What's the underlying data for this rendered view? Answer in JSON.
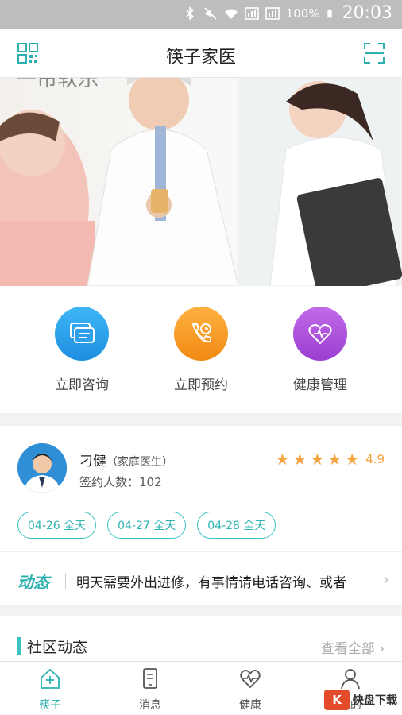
{
  "status_bar": {
    "battery": "100%",
    "time": "20:03"
  },
  "app_bar": {
    "title": "筷子家医"
  },
  "banner": {
    "overlay_text": "一帘软乐",
    "page_count": 3,
    "active_page": 2
  },
  "quick_actions": [
    {
      "label": "立即咨询",
      "icon": "chat-bubbles-icon",
      "color": "#2f9ce8"
    },
    {
      "label": "立即预约",
      "icon": "phone-clock-icon",
      "color": "#f39b1e"
    },
    {
      "label": "健康管理",
      "icon": "heart-monitor-icon",
      "color": "#a452d6"
    }
  ],
  "doctor": {
    "name": "刁健",
    "role": "（家庭医生）",
    "signed_label": "签约人数：",
    "signed_count": "102",
    "rating": "4.9",
    "stars": 5,
    "available_dates": [
      "04-26 全天",
      "04-27 全天",
      "04-28 全天"
    ]
  },
  "news": {
    "tag": "动态",
    "text": "明天需要外出进修，有事情请电话咨询、或者"
  },
  "community": {
    "title": "社区动态",
    "more_label": "查看全部"
  },
  "tabs": [
    {
      "label": "筷子",
      "icon": "home-plus-icon",
      "active": true
    },
    {
      "label": "消息",
      "icon": "message-phone-icon",
      "active": false
    },
    {
      "label": "健康",
      "icon": "heart-pulse-icon",
      "active": false
    },
    {
      "label": "我的",
      "icon": "person-icon",
      "active": false
    }
  ],
  "watermark": {
    "text": "快盘下载",
    "badge": "K"
  },
  "colors": {
    "accent": "#2bb0b0",
    "star": "#f5a340",
    "status_bar": "#bdbdbd"
  }
}
